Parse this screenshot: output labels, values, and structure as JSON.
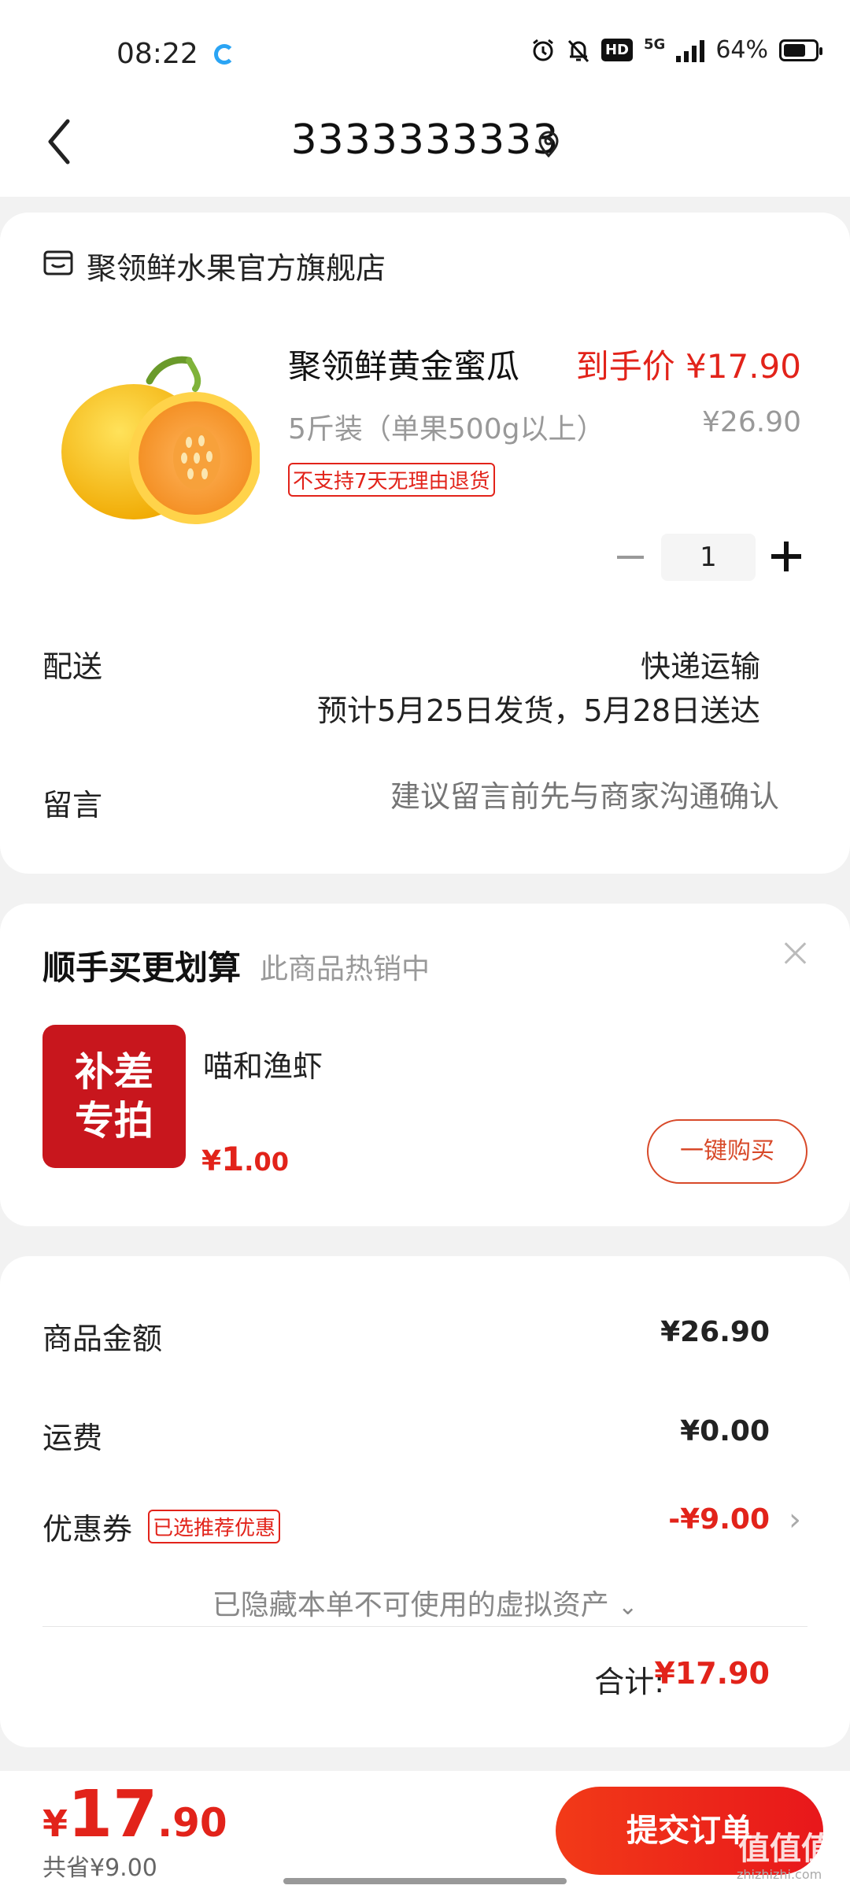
{
  "status": {
    "time": "08:22",
    "net": "5G",
    "battery": "64%"
  },
  "header": {
    "title": "3333333333"
  },
  "store": {
    "name": "聚领鲜水果官方旗舰店"
  },
  "product": {
    "name": "聚领鲜黄金蜜瓜",
    "final_price": "到手价 ¥17.90",
    "spec": "5斤装（单果500g以上）",
    "original_price": "¥26.90",
    "tag": "不支持7天无理由退货",
    "quantity": "1"
  },
  "shipping": {
    "label": "配送",
    "method": "快递运输",
    "eta": "预计5月25日发货，5月28日送达"
  },
  "message": {
    "label": "留言",
    "placeholder": "建议留言前先与商家沟通确认"
  },
  "upsell": {
    "title": "顺手买更划算",
    "subtitle": "此商品热销中",
    "badge_line1": "补差",
    "badge_line2": "专拍",
    "item_name": "喵和渔虾",
    "price_symbol": "¥",
    "price_int": "1",
    "price_dec": ".00",
    "button": "一键购买"
  },
  "summary": {
    "goods_label": "商品金额",
    "goods_value": "¥26.90",
    "freight_label": "运费",
    "freight_value": "¥0.00",
    "coupon_label": "优惠券",
    "coupon_tag": "已选推荐优惠",
    "coupon_value": "-¥9.00",
    "hidden_note": "已隐藏本单不可使用的虚拟资产",
    "total_label": "合计:",
    "total_value": "¥17.90"
  },
  "bottom": {
    "price_symbol": "¥",
    "price_int": "17",
    "price_dec": ".90",
    "saved": "共省¥9.00",
    "submit": "提交订单"
  },
  "watermark": {
    "text": "值值值",
    "url": "zhizhizhi.com"
  },
  "colors": {
    "accent": "#e2231a",
    "badge": "#c8161d"
  }
}
